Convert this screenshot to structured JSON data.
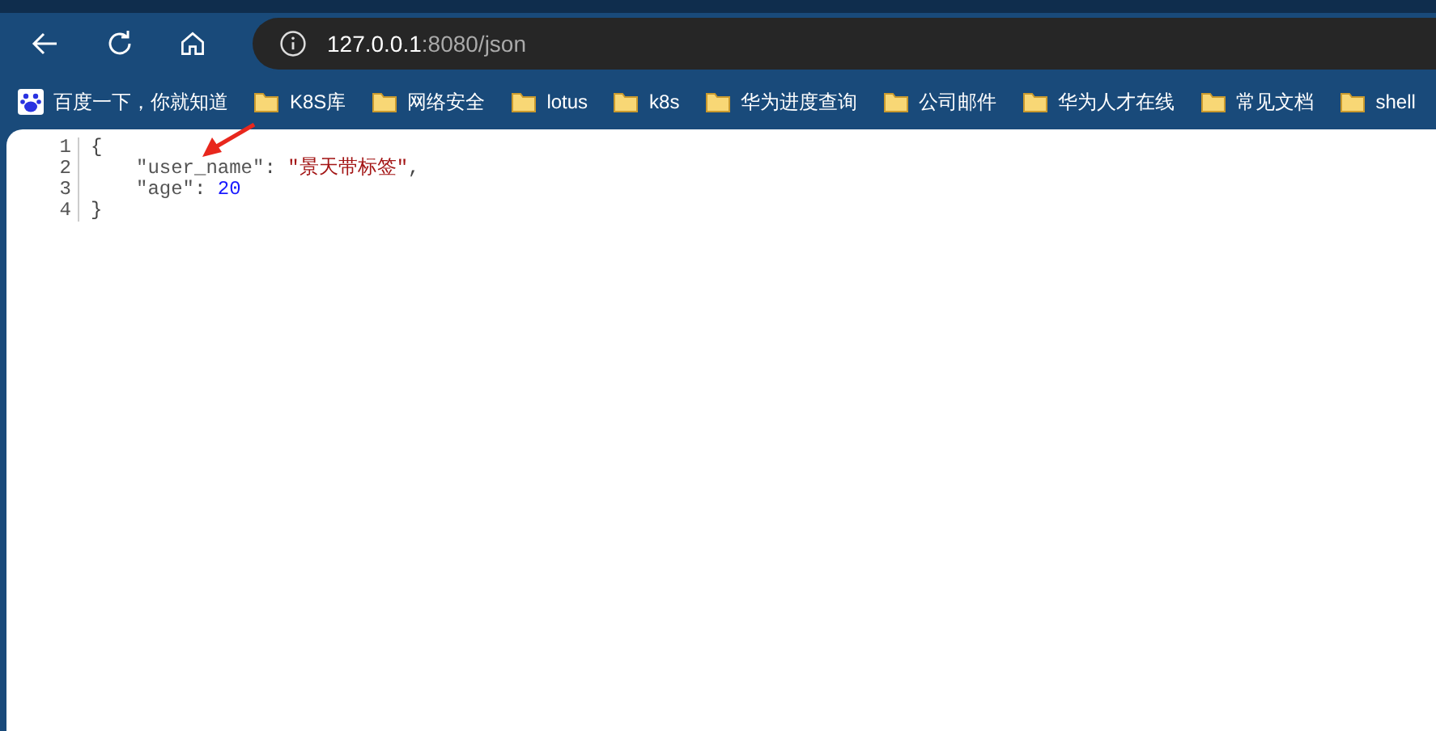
{
  "toolbar": {
    "url_host": "127.0.0.1",
    "url_rest": ":8080/json"
  },
  "bookmarks": [
    {
      "label": "百度一下，你就知道",
      "kind": "site"
    },
    {
      "label": "K8S库",
      "kind": "folder"
    },
    {
      "label": "网络安全",
      "kind": "folder"
    },
    {
      "label": "lotus",
      "kind": "folder"
    },
    {
      "label": "k8s",
      "kind": "folder"
    },
    {
      "label": "华为进度查询",
      "kind": "folder"
    },
    {
      "label": "公司邮件",
      "kind": "folder"
    },
    {
      "label": "华为人才在线",
      "kind": "folder"
    },
    {
      "label": "常见文档",
      "kind": "folder"
    },
    {
      "label": "shell",
      "kind": "folder"
    }
  ],
  "code": {
    "lines": [
      {
        "number": "1",
        "indented": false,
        "tokens": [
          {
            "kind": "punct",
            "text": "{"
          }
        ]
      },
      {
        "number": "2",
        "indented": true,
        "tokens": [
          {
            "kind": "key",
            "text": "\"user_name\""
          },
          {
            "kind": "punct",
            "text": ": "
          },
          {
            "kind": "string",
            "text": "\"景天带标签\""
          },
          {
            "kind": "punct",
            "text": ","
          }
        ]
      },
      {
        "number": "3",
        "indented": true,
        "tokens": [
          {
            "kind": "key",
            "text": "\"age\""
          },
          {
            "kind": "punct",
            "text": ": "
          },
          {
            "kind": "number",
            "text": "20"
          }
        ]
      },
      {
        "number": "4",
        "indented": false,
        "tokens": [
          {
            "kind": "punct",
            "text": "}"
          }
        ]
      }
    ]
  }
}
